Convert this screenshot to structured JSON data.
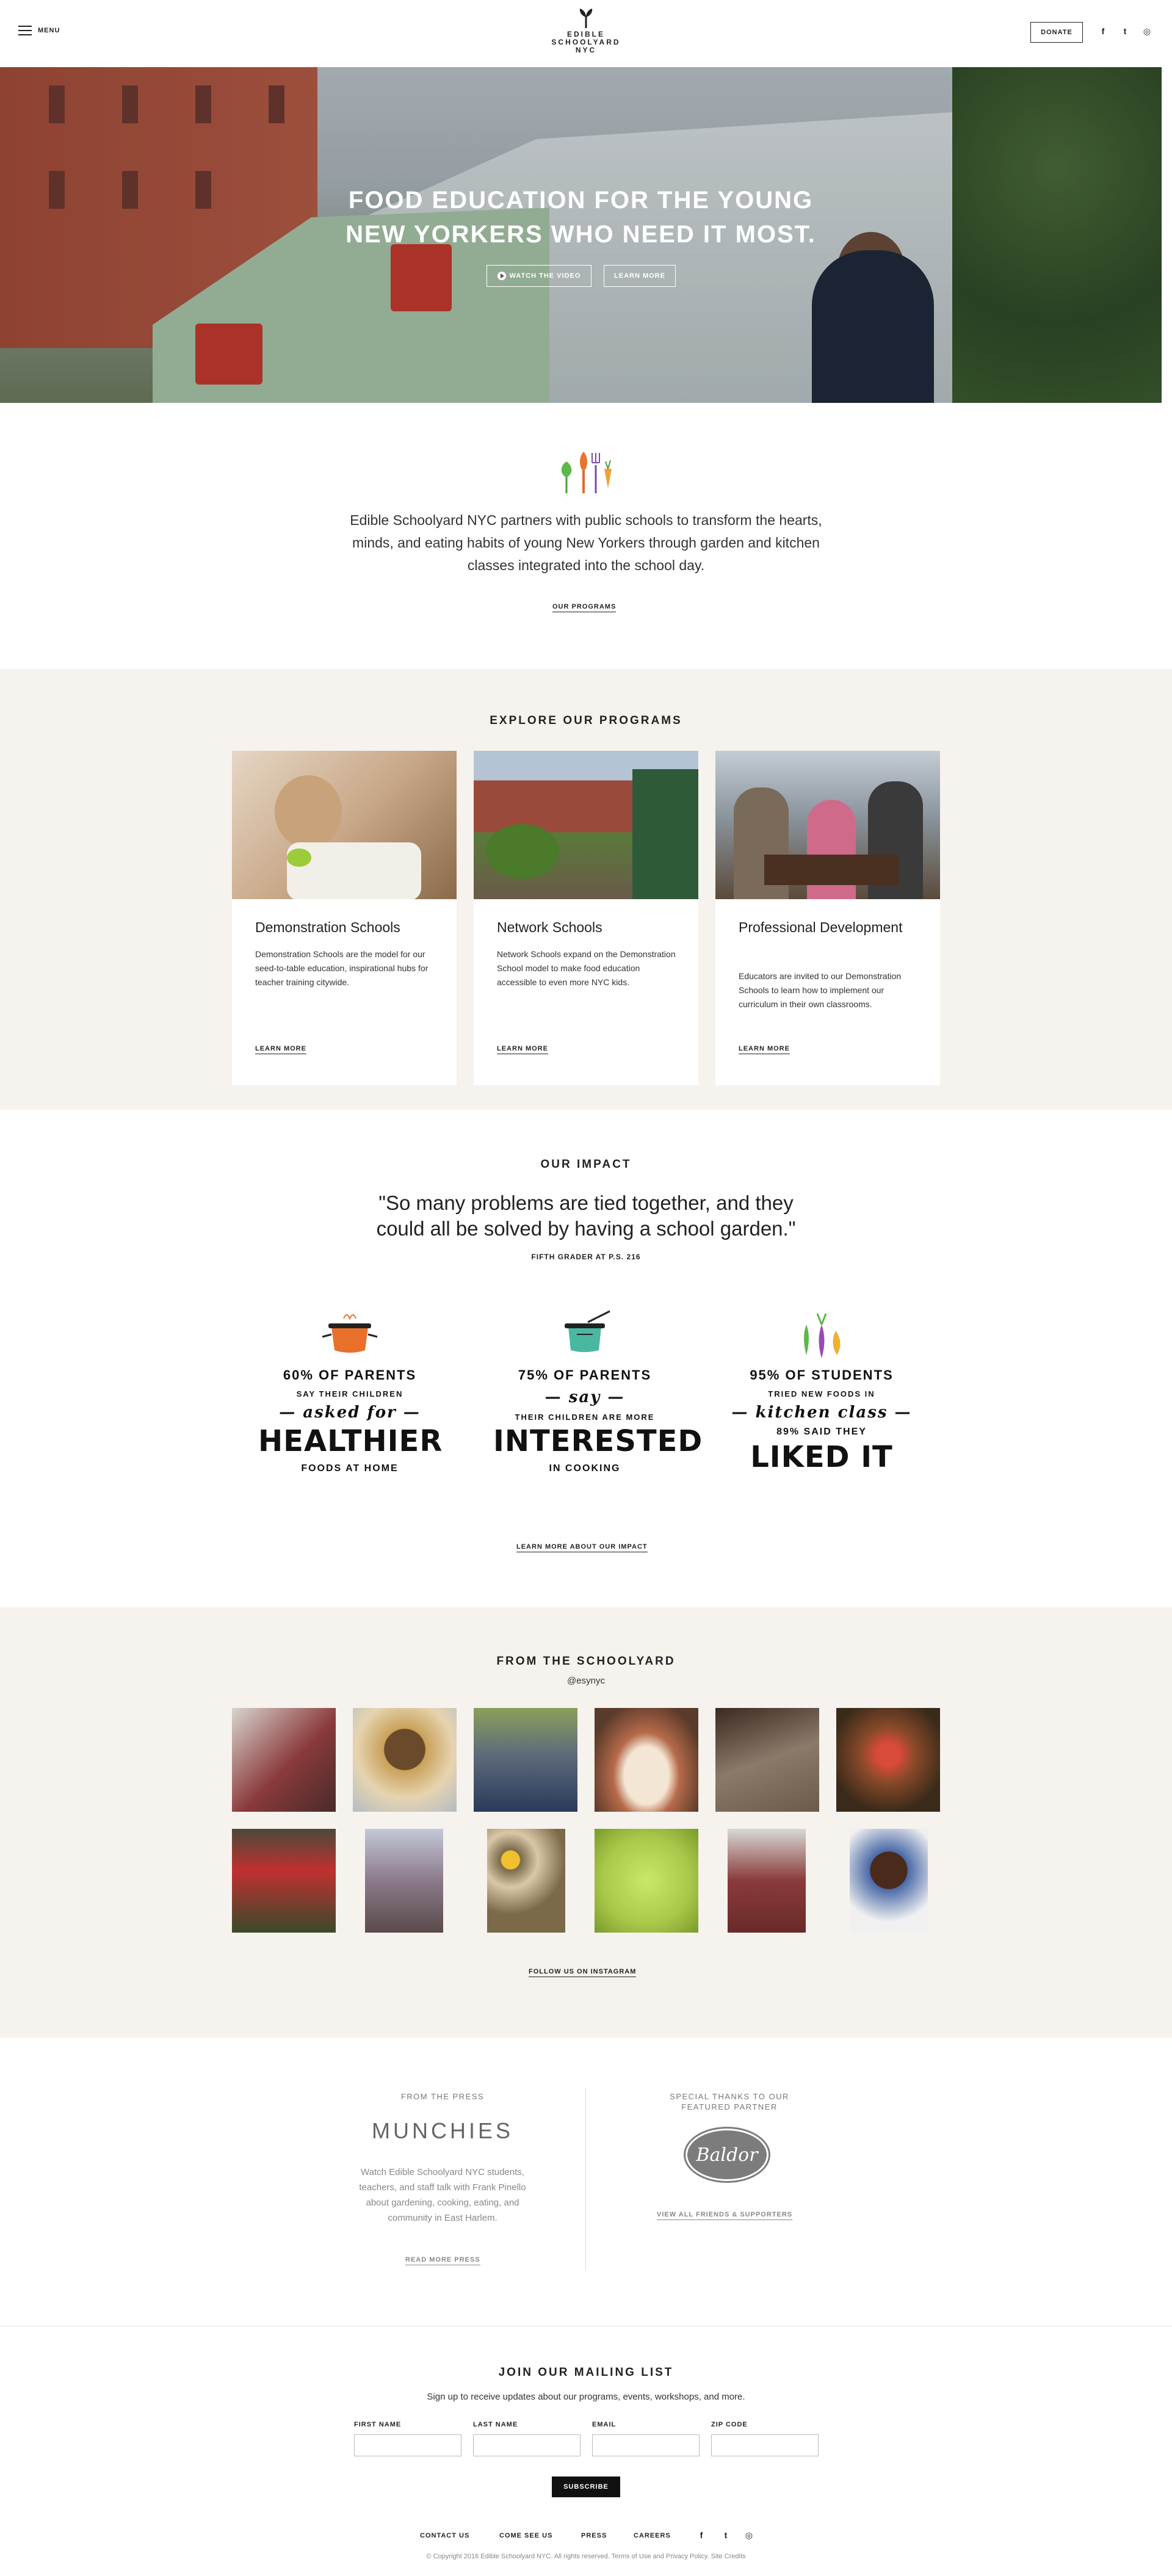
{
  "header": {
    "menu_label": "MENU",
    "logo_text": "EDIBLE\nSCHOOLYARD\nNYC",
    "donate_label": "DONATE",
    "social": {
      "facebook": "f",
      "twitter": "t",
      "instagram": "◎"
    }
  },
  "hero": {
    "title": "FOOD EDUCATION FOR THE YOUNG\nNEW YORKERS WHO NEED IT MOST.",
    "watch_label": "WATCH THE VIDEO",
    "learn_label": "LEARN MORE",
    "slides": 2,
    "active_slide": 1
  },
  "intro": {
    "text": "Edible Schoolyard NYC partners with public schools to transform the hearts, minds, and eating habits of young New Yorkers through garden and kitchen classes integrated into the school day.",
    "link": "OUR PROGRAMS"
  },
  "programs": {
    "heading": "EXPLORE OUR PROGRAMS",
    "cards": [
      {
        "title": "Demonstration Schools",
        "desc": "Demonstration Schools are the model for our seed-to-table education, inspirational hubs for teacher training citywide.",
        "link": "LEARN MORE"
      },
      {
        "title": "Network Schools",
        "desc": "Network Schools expand on the Demonstration School model to make food education accessible to even more NYC kids.",
        "link": "LEARN MORE"
      },
      {
        "title": "Professional Development",
        "desc": "Educators are invited to our Demonstration Schools to learn how to implement our curriculum in their own classrooms.",
        "link": "LEARN MORE"
      }
    ]
  },
  "impact": {
    "heading": "OUR IMPACT",
    "quote": "\"So many problems are tied together, and they\ncould all be solved by having a school garden.\"",
    "quote_source": "FIFTH GRADER AT P.S. 216",
    "stats": [
      {
        "line1": "60% OF PARENTS",
        "line2": "SAY THEIR CHILDREN",
        "script": "— asked for —",
        "big": "HEALTHIER",
        "line3": "FOODS AT HOME",
        "icon": "pot-icon"
      },
      {
        "line1": "75% OF PARENTS",
        "line2": "THEIR CHILDREN ARE MORE",
        "script": "— say —",
        "big": "INTERESTED",
        "line3": "IN COOKING",
        "icon": "pot-icon"
      },
      {
        "line1": "95% OF STUDENTS",
        "line2": "TRIED NEW FOODS IN",
        "script": "— kitchen class —",
        "big": "LIKED IT",
        "line3": "89% SAID THEY",
        "icon": "vegetables-icon"
      }
    ],
    "link": "LEARN MORE ABOUT OUR IMPACT"
  },
  "schoolyard": {
    "heading": "FROM THE SCHOOLYARD",
    "handle": "@esynyc",
    "link": "FOLLOW US ON INSTAGRAM",
    "photo_colors": [
      "#8a3a3a",
      "#c9a15a",
      "#5d6b7a",
      "#b66a4a",
      "#6b5a4a",
      "#5a2a2a",
      "#3a4a2a",
      "#8a7a8a",
      "#7a6a4a",
      "#a8c84a",
      "#8a3a3a",
      "#4a6aa8"
    ]
  },
  "press": {
    "from_label": "FROM THE PRESS",
    "outlet": "MUNCHIES",
    "desc": "Watch Edible Schoolyard NYC students, teachers, and staff talk with Frank Pinello about gardening, cooking, eating, and community in East Harlem.",
    "link": "READ MORE PRESS",
    "partner_label": "SPECIAL THANKS TO OUR\nFEATURED PARTNER",
    "partner_name": "Baldor",
    "partner_link": "VIEW ALL FRIENDS & SUPPORTERS"
  },
  "mailing": {
    "heading": "JOIN OUR MAILING LIST",
    "subtitle": "Sign up to receive updates about our programs, events, workshops, and more.",
    "fields": [
      "FIRST NAME",
      "LAST NAME",
      "EMAIL",
      "ZIP CODE"
    ],
    "subscribe": "SUBSCRIBE"
  },
  "footer": {
    "links": [
      "CONTACT US",
      "COME SEE US",
      "PRESS",
      "CAREERS"
    ],
    "copyright": "© Copyright 2016 Edible Schoolyard NYC. All rights reserved. Terms of Use and Privacy Policy. Site Credits"
  }
}
